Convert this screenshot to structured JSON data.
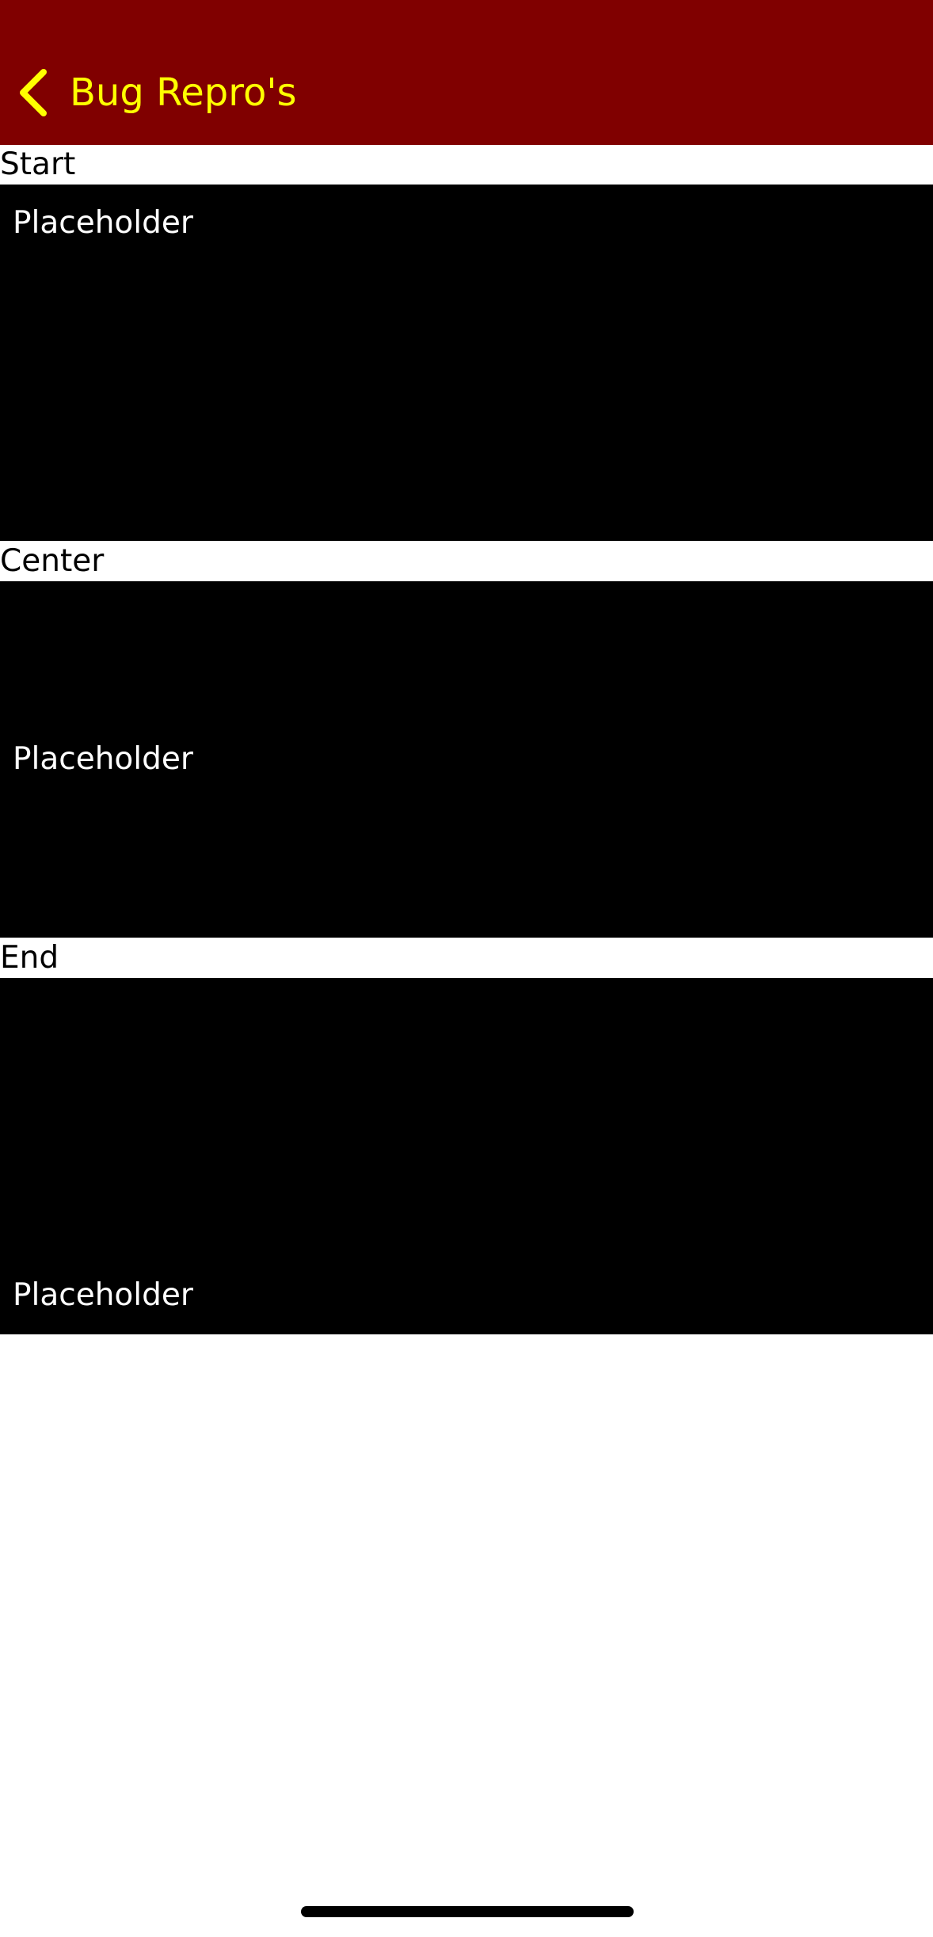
{
  "nav_bar": {
    "back_label": "Bug Repro's",
    "background_color": "#800000",
    "tint_color": "#ffff00",
    "back_icon": "chevron-left-icon"
  },
  "sections": [
    {
      "label": "Start",
      "placeholder": "Placeholder",
      "vertical_alignment": "start"
    },
    {
      "label": "Center",
      "placeholder": "Placeholder",
      "vertical_alignment": "center"
    },
    {
      "label": "End",
      "placeholder": "Placeholder",
      "vertical_alignment": "end"
    }
  ],
  "colors": {
    "page_background": "#ffffff",
    "box_background": "#000000",
    "box_text": "#ffffff",
    "label_text": "#000000"
  }
}
